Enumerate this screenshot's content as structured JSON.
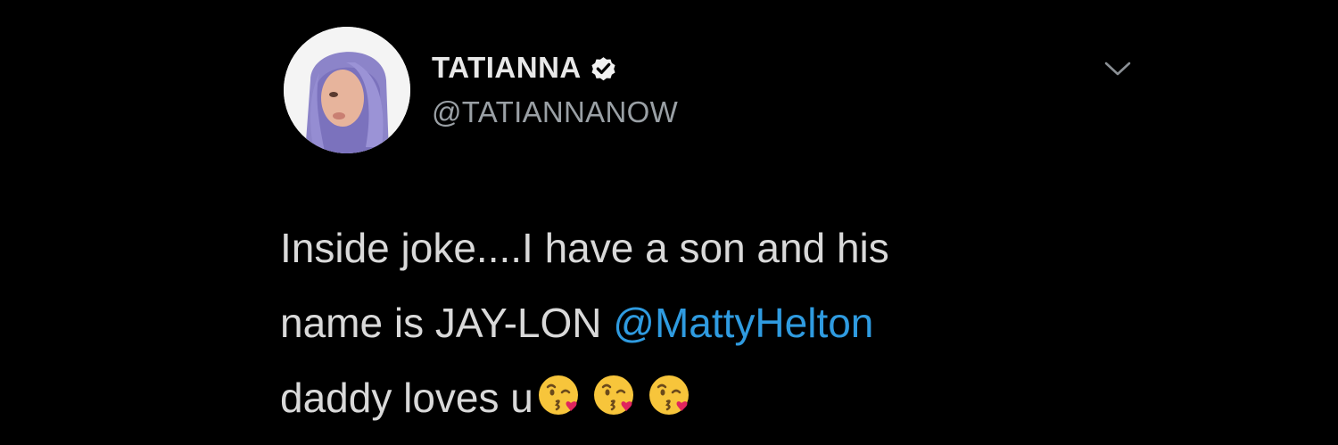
{
  "colors": {
    "background": "#000000",
    "name": "#e8e8e8",
    "handle": "#9aa0a5",
    "text": "#d9d9d9",
    "mention": "#2f9be0",
    "verified_badge": "#f2f2f2"
  },
  "tweet": {
    "display_name": "TATIANNA",
    "verified": true,
    "handle": "@TATIANNANOW",
    "text": {
      "line1": "Inside joke....I have a son and his",
      "line2_prefix": "name is JAY-LON ",
      "mention": "@MattyHelton",
      "line3_prefix": "daddy loves u"
    },
    "emojis": [
      "face-blowing-a-kiss",
      "face-blowing-a-kiss",
      "face-blowing-a-kiss"
    ]
  },
  "icons": {
    "avatar": "profile-photo",
    "verified": "verified-badge-icon",
    "menu": "chevron-down-icon"
  }
}
